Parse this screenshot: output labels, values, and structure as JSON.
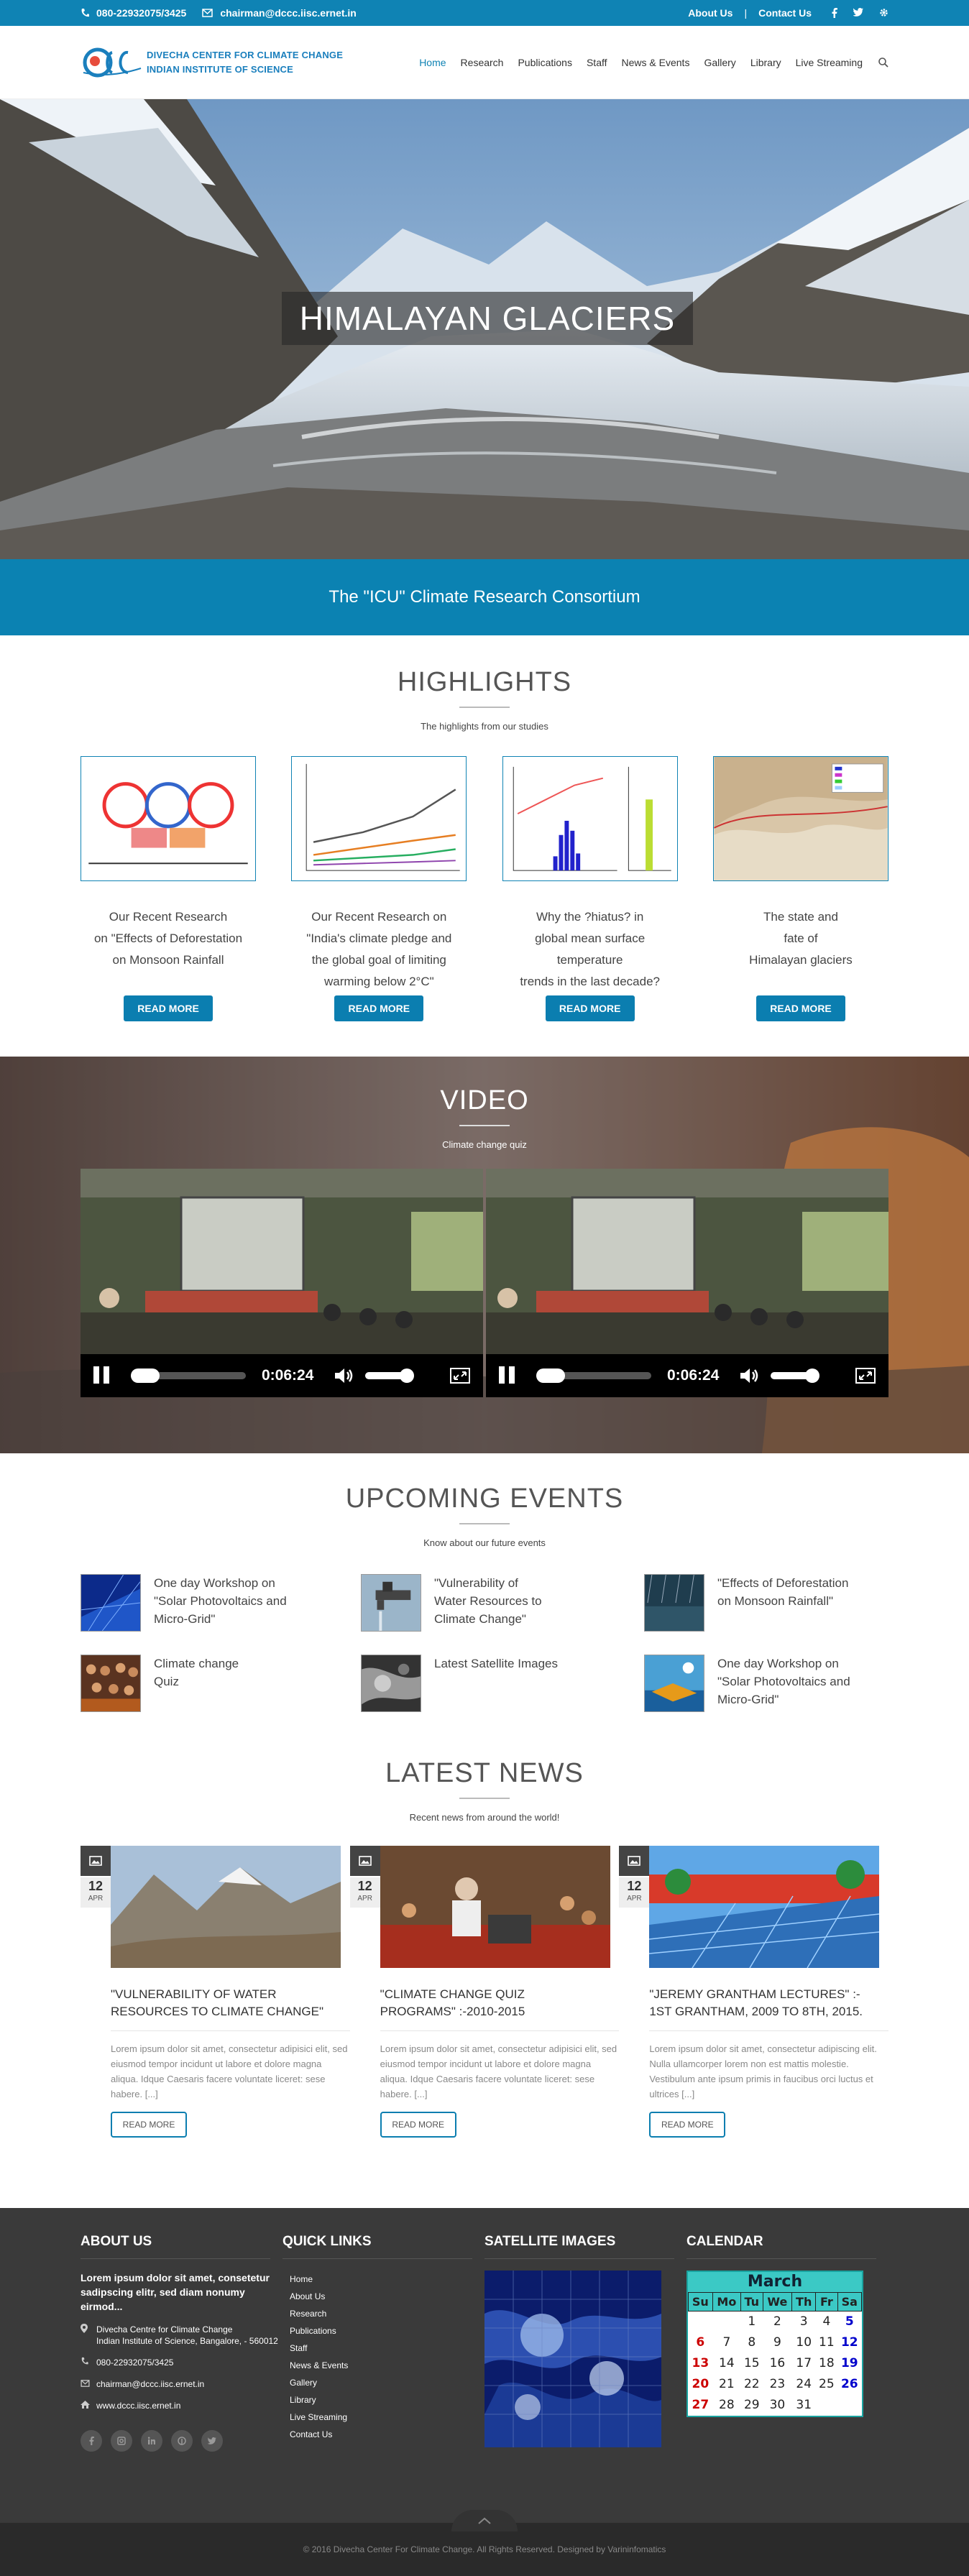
{
  "topbar": {
    "phone": "080-22932075/3425",
    "email": "chairman@dccc.iisc.ernet.in",
    "links": [
      "About Us",
      "Contact Us"
    ],
    "separator": "|"
  },
  "header": {
    "logo_line1": "DIVECHA CENTER FOR CLIMATE CHANGE",
    "logo_line2": "INDIAN INSTITUTE OF SCIENCE",
    "nav": [
      "Home",
      "Research",
      "Publications",
      "Staff",
      "News & Events",
      "Gallery",
      "Library",
      "Live Streaming"
    ]
  },
  "hero": {
    "title": "HIMALAYAN GLACIERS"
  },
  "consortium": "The \"ICU\" Climate Research Consortium",
  "highlights": {
    "title": "HIGHLIGHTS",
    "subtitle": "The highlights from our studies",
    "button": "READ MORE",
    "items": [
      {
        "l1": "Our Recent Research",
        "l2": "on \"Effects of Deforestation",
        "l3": "on Monsoon Rainfall",
        "l4": ""
      },
      {
        "l1": "Our Recent Research on",
        "l2": "\"India's climate pledge and",
        "l3": "the global goal of limiting",
        "l4": "warming below 2°C\""
      },
      {
        "l1": "Why the ?hiatus? in",
        "l2": "global mean surface temperature",
        "l3": "trends in the last decade?",
        "l4": ""
      },
      {
        "l1": "The state and",
        "l2": "fate of",
        "l3": "Himalayan glaciers",
        "l4": ""
      }
    ]
  },
  "video": {
    "title": "VIDEO",
    "subtitle": "Climate change quiz",
    "time": "0:06:24"
  },
  "events": {
    "title": "UPCOMING EVENTS",
    "subtitle": "Know about our future events",
    "items": [
      {
        "l1": "One day Workshop on",
        "l2": "\"Solar Photovoltaics and",
        "l3": "Micro-Grid\""
      },
      {
        "l1": "\"Vulnerability of",
        "l2": "Water Resources to",
        "l3": "Climate Change\""
      },
      {
        "l1": "\"Effects of Deforestation",
        "l2": "on Monsoon Rainfall\"",
        "l3": ""
      },
      {
        "l1": "Climate change",
        "l2": "Quiz",
        "l3": ""
      },
      {
        "l1": "Latest Satellite Images",
        "l2": "",
        "l3": ""
      },
      {
        "l1": "One day Workshop on",
        "l2": "\"Solar Photovoltaics and",
        "l3": "Micro-Grid\""
      }
    ]
  },
  "news": {
    "title": "LATEST NEWS",
    "subtitle": "Recent news from around the world!",
    "button": "READ MORE",
    "items": [
      {
        "day": "12",
        "month": "APR",
        "t1": "\"VULNERABILITY OF WATER",
        "t2": "RESOURCES TO CLIMATE CHANGE\"",
        "body": "Lorem ipsum dolor sit amet, consectetur adipisici elit, sed eiusmod tempor incidunt ut labore et dolore magna aliqua. Idque Caesaris facere voluntate liceret: sese habere. [...]"
      },
      {
        "day": "12",
        "month": "APR",
        "t1": "\"CLIMATE CHANGE QUIZ",
        "t2": "PROGRAMS\" :-2010-2015",
        "body": "Lorem ipsum dolor sit amet, consectetur adipisici elit, sed eiusmod tempor incidunt ut labore et dolore magna aliqua. Idque Caesaris facere voluntate liceret: sese habere. [...]"
      },
      {
        "day": "12",
        "month": "APR",
        "t1": "\"JEREMY GRANTHAM LECTURES\" :-",
        "t2": "1ST GRANTHAM, 2009 TO 8TH, 2015.",
        "body": "Lorem ipsum dolor sit amet, consectetur adipiscing elit. Nulla ullamcorper lorem non est mattis molestie. Vestibulum ante ipsum primis in faucibus orci luctus et ultrices [...]"
      }
    ]
  },
  "footer": {
    "about_title": "ABOUT US",
    "about_text": "Lorem ipsum dolor sit amet, consetetur sadipscing elitr, sed diam nonumy eirmod...",
    "address1": "Divecha Centre for Climate Change",
    "address2": "Indian Institute of Science, Bangalore, - 560012",
    "phone": "080-22932075/3425",
    "email": "chairman@dccc.iisc.ernet.in",
    "web": "www.dccc.iisc.ernet.in",
    "quick_title": "QUICK LINKS",
    "quick_links": [
      "Home",
      "About Us",
      "Research",
      "Publications",
      "Staff",
      "News & Events",
      "Gallery",
      "Library",
      "Live Streaming",
      "Contact Us"
    ],
    "sat_title": "SATELLITE IMAGES",
    "cal_title": "CALENDAR",
    "cal_month": "March",
    "cal_days": [
      "Su",
      "Mo",
      "Tu",
      "We",
      "Th",
      "Fr",
      "Sa"
    ],
    "cal_weeks": [
      [
        "",
        "",
        "1",
        "2",
        "3",
        "4",
        "5"
      ],
      [
        "6",
        "7",
        "8",
        "9",
        "10",
        "11",
        "12"
      ],
      [
        "13",
        "14",
        "15",
        "16",
        "17",
        "18",
        "19"
      ],
      [
        "20",
        "21",
        "22",
        "23",
        "24",
        "25",
        "26"
      ],
      [
        "27",
        "28",
        "29",
        "30",
        "31",
        "",
        ""
      ]
    ],
    "copyright": "© 2016 Divecha Center For Climate Change. All Rights Reserved. Designed by Varininfomatics"
  },
  "colors": {
    "primary": "#0f83b4",
    "footer_bg": "#3a3a3a",
    "calendar": "#3bc9c5"
  }
}
